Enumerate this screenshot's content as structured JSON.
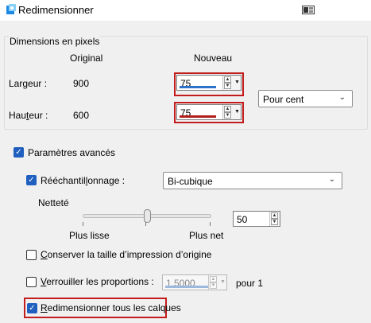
{
  "window": {
    "title": "Redimensionner",
    "icon": "paint-app-icon",
    "snap_icon": "window-snap-icon"
  },
  "pixel_dimensions": {
    "group_title": "Dimensions en pixels",
    "col_original": "Original",
    "col_new": "Nouveau",
    "width": {
      "label_pre": "Lar",
      "label_u": "g",
      "label_post": "eur :",
      "original": "900",
      "new_value": "75"
    },
    "height": {
      "label_pre": "Hau",
      "label_u": "t",
      "label_post": "eur :",
      "original": "600",
      "new_value": "75"
    },
    "unit": {
      "selected": "Pour cent"
    }
  },
  "advanced": {
    "label": "Paramètres avancés",
    "checked": true,
    "resample": {
      "label_pre": "Rééchantil",
      "label_u": "l",
      "label_post": "onnage :",
      "checked": true,
      "method": "Bi-cubique"
    },
    "sharpness": {
      "label": "Netteté",
      "min_label": "Plus lisse",
      "max_label": "Plus net",
      "value": "50",
      "level": 0.5
    },
    "keep_print_size": {
      "label_u": "C",
      "label_post": "onserver la taille d’impression d’origine",
      "checked": false
    },
    "lock_ratio": {
      "label_u": "V",
      "label_post": "errouiller les proportions :",
      "checked": false,
      "value": "1.5000",
      "suffix": "pour 1"
    },
    "resize_all_layers": {
      "label_u": "R",
      "label_post": "edimensionner tous les calques",
      "checked": true
    }
  },
  "colors": {
    "accent": "#1f5fbf",
    "highlight": "#c21c1c",
    "progress_blue": "#2f74c8"
  }
}
